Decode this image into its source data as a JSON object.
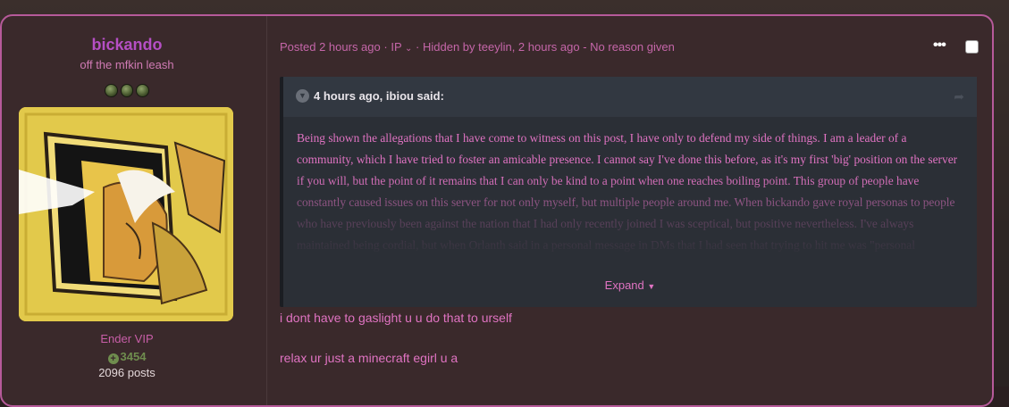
{
  "author": {
    "username": "bickando",
    "title": "off the mfkin leash",
    "group": "Ender VIP",
    "reputation": "3454",
    "post_count": "2096 posts",
    "avatar_icon": "anime-character-avatar"
  },
  "post": {
    "meta_posted": "Posted 2 hours ago",
    "meta_ip": "IP",
    "meta_hidden": "Hidden by teeylin, 2 hours ago - No reason given",
    "more_icon": "ellipsis-icon",
    "quote": {
      "citation": "4 hours ago, ibiou said:",
      "body": "Being shown the allegations that I have come to witness on this post, I have only to defend my side of things. I am a leader of a community, which I have tried to foster an amicable presence. I cannot say I've done this before, as it's my first 'big' position on the server if you will, but the point of it remains that I can only be kind to a point when one reaches boiling point. This group of people have constantly caused issues on this server for not only myself, but multiple people around me. When bickando gave royal personas to people who have previously been against the nation that I had only recently joined I was sceptical, but positive nevertheless. I've always maintained being cordial, but when Orlanth said in a personal message in DMs that I had seen that trying to hit me was \"personal retribution\" for not getting Alex/Olog (screenshot below), and then the amount of times a friend of mine had been found in",
      "expand_label": "Expand"
    },
    "replies": [
      "i dont have to gaslight u u do that to urself",
      "relax ur just a minecraft egirl u a"
    ]
  },
  "colors": {
    "accent_pink": "#e073c2",
    "username_purple": "#b54fc4",
    "border_pink": "#b65a9a",
    "rep_green": "#6f8d4e"
  }
}
